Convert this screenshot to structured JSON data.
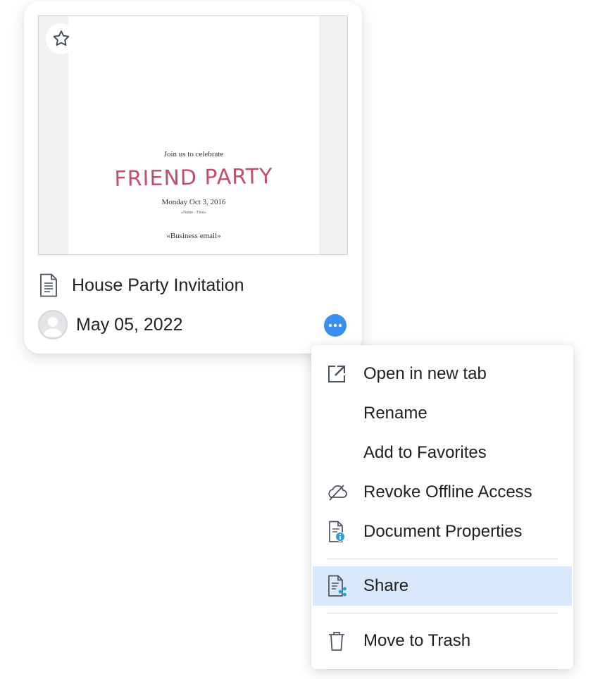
{
  "card": {
    "thumbnail": {
      "line1": "Join us to celebrate",
      "title": "FRIEND PARTY",
      "date": "Monday Oct 3, 2016",
      "small": "«Name - First»",
      "email": "«Business email»"
    },
    "title": "House Party Invitation",
    "date": "May 05, 2022",
    "icons": {
      "favorite": "star-outline-icon",
      "document": "document-icon",
      "avatar": "user-avatar-icon",
      "more": "more-horizontal-icon"
    }
  },
  "menu": {
    "items": [
      {
        "label": "Open in new tab",
        "icon": "open-external-icon"
      },
      {
        "label": "Rename",
        "icon": ""
      },
      {
        "label": "Add to Favorites",
        "icon": ""
      },
      {
        "label": "Revoke Offline Access",
        "icon": "cloud-off-icon"
      },
      {
        "label": "Document Properties",
        "icon": "document-info-icon"
      },
      {
        "label": "Share",
        "icon": "document-share-icon"
      },
      {
        "label": "Move to Trash",
        "icon": "trash-icon"
      }
    ],
    "highlighted": "Share"
  },
  "colors": {
    "accent": "#3b8ef0",
    "highlight": "#d9e8fb",
    "invite_title": "#c0506a",
    "icon": "#4a5360"
  }
}
